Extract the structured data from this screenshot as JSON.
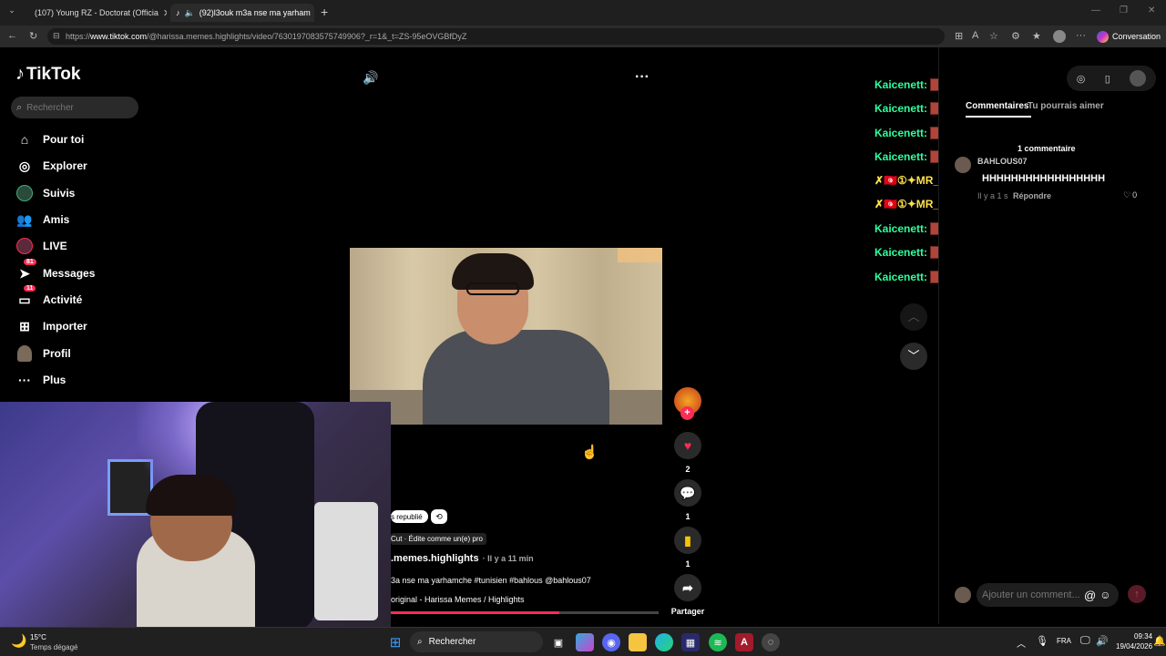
{
  "browser": {
    "tabs": [
      {
        "label": "(107) Young RZ - Doctorat (Officia",
        "icon": "youtube-icon",
        "active": false
      },
      {
        "label": "(92)l3ouk m3a nse ma yarham",
        "icon": "tiktok-icon",
        "active": true
      }
    ],
    "new_tab": "+",
    "url_host": "www.tiktok.com",
    "url_prefix": "https://",
    "url_path": "/@harissa.memes.highlights/video/7630197083575749906?_r=1&_t=ZS-95eOVGBfDyZ",
    "copilot_label": "Conversation"
  },
  "sidebar": {
    "logo": "TikTok",
    "search_placeholder": "Rechercher",
    "items": [
      {
        "label": "Pour toi",
        "icon": "home-icon"
      },
      {
        "label": "Explorer",
        "icon": "compass-icon"
      },
      {
        "label": "Suivis",
        "icon": "following-avatar-icon"
      },
      {
        "label": "Amis",
        "icon": "friends-icon"
      },
      {
        "label": "LIVE",
        "icon": "live-avatar-icon"
      },
      {
        "label": "Messages",
        "icon": "messages-icon",
        "badge": "81"
      },
      {
        "label": "Activité",
        "icon": "activity-icon",
        "badge": "11"
      },
      {
        "label": "Importer",
        "icon": "plus-square-icon"
      },
      {
        "label": "Profil",
        "icon": "profile-avatar-icon"
      },
      {
        "label": "Plus",
        "icon": "more-dots-icon"
      }
    ]
  },
  "video": {
    "reposted_label": "s republié",
    "capcut_label": "Cut · Édite comme un(e) pro",
    "author": ".memes.highlights",
    "time": "· Il y a 11 min",
    "caption": "3a nse ma yarhamche #tunisien #bahlous @bahlous07",
    "music": "original - Harissa Memes / Highlights",
    "progress": 0.63
  },
  "actions": {
    "likes": "2",
    "comments": "1",
    "saves": "1",
    "share_label": "Partager"
  },
  "chat_overlay": [
    {
      "user": "Kaicenett:",
      "style": "green"
    },
    {
      "user": "Kaicenett:",
      "style": "green"
    },
    {
      "user": "Kaicenett:",
      "style": "green"
    },
    {
      "user": "Kaicenett:",
      "style": "green"
    },
    {
      "user": "✗🇹🇳①✦MR_STOO:",
      "style": "yellow"
    },
    {
      "user": "✗🇹🇳①✦MR_STOO:",
      "style": "yellow"
    },
    {
      "user": "Kaicenett:",
      "style": "green"
    },
    {
      "user": "Kaicenett:",
      "style": "green"
    },
    {
      "user": "Kaicenett:",
      "style": "green"
    }
  ],
  "comments_panel": {
    "tab_comments": "Commentaires",
    "tab_suggested": "Tu pourrais aimer",
    "count_label": "1 commentaire",
    "comment": {
      "user": "BAHLOUS07",
      "text": "HHHHHHHHHHHHHHHHH",
      "time": "Il y a 1 s",
      "reply": "Répondre",
      "likes": "0"
    },
    "input_placeholder": "Ajouter un comment..."
  },
  "taskbar": {
    "weather_temp": "15°C",
    "weather_desc": "Temps dégagé",
    "search_label": "Rechercher",
    "lang": "FRA",
    "time": "09:34",
    "date": "19/04/2026"
  },
  "colors": {
    "accent": "#fe2c55",
    "chat_green": "#2eff9d",
    "chat_yellow": "#ffe14a",
    "save_yellow": "#f7c600"
  }
}
